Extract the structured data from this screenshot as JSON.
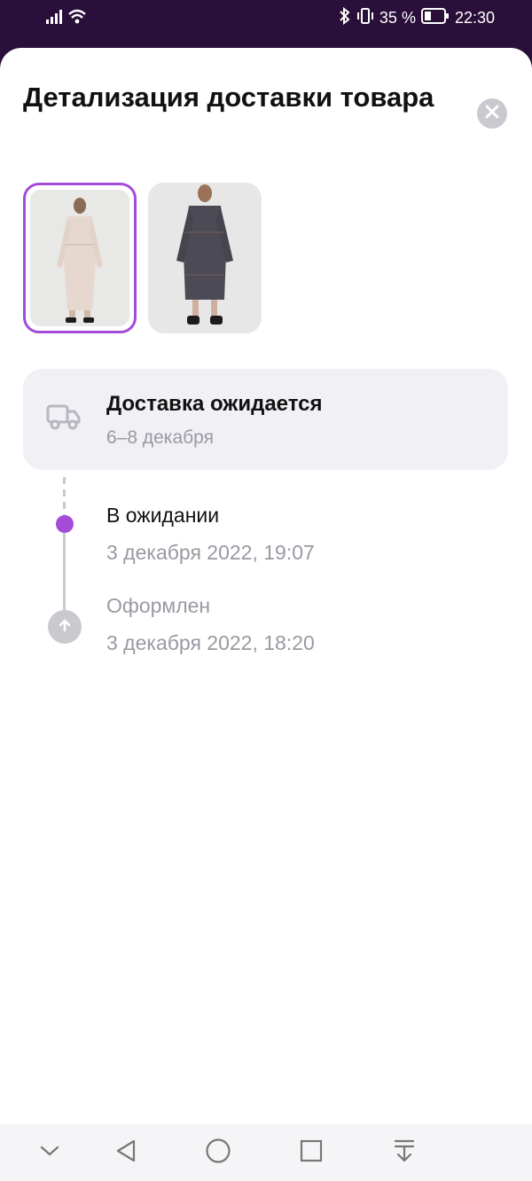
{
  "status_bar": {
    "battery_percent_label": "35 %",
    "time": "22:30",
    "battery_level": 0.35
  },
  "sheet": {
    "title": "Детализация доставки товара"
  },
  "thumbnails": [
    {
      "selected": true,
      "description_color": "#e6d8cf"
    },
    {
      "selected": false,
      "description_color": "#4b4a55"
    }
  ],
  "delivery_card": {
    "heading": "Доставка ожидается",
    "dates": "6–8 декабря"
  },
  "timeline": [
    {
      "title": "В ожидании",
      "date": "3 декабря 2022, 19:07",
      "state": "active"
    },
    {
      "title": "Оформлен",
      "date": "3 декабря 2022, 18:20",
      "state": "done"
    }
  ],
  "colors": {
    "accent": "#a44bd8",
    "status_bar_bg": "#2a0f3a",
    "muted_text": "#9a99a2",
    "card_bg": "#f1f0f5"
  }
}
